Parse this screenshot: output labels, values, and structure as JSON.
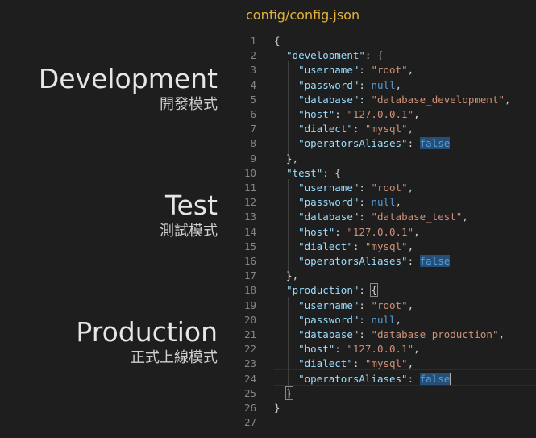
{
  "file_title": "config/config.json",
  "labels": {
    "development": {
      "title": "Development",
      "subtitle": "開發模式"
    },
    "test": {
      "title": "Test",
      "subtitle": "測試模式"
    },
    "production": {
      "title": "Production",
      "subtitle": "正式上線模式"
    }
  },
  "editor": {
    "line_numbers": [
      "1",
      "2",
      "3",
      "4",
      "5",
      "6",
      "7",
      "8",
      "9",
      "10",
      "11",
      "12",
      "13",
      "14",
      "15",
      "16",
      "17",
      "18",
      "19",
      "20",
      "21",
      "22",
      "23",
      "24",
      "25",
      "26",
      "27"
    ],
    "code": {
      "open": "{",
      "close": "}",
      "development_key": "\"development\"",
      "test_key": "\"test\"",
      "production_key": "\"production\"",
      "username_key": "\"username\"",
      "password_key": "\"password\"",
      "database_key": "\"database\"",
      "host_key": "\"host\"",
      "dialect_key": "\"dialect\"",
      "operators_key": "\"operatorsAliases\"",
      "root": "\"root\"",
      "null": "null",
      "false": "false",
      "host_value": "\"127.0.0.1\"",
      "dialect_value": "\"mysql\"",
      "db_dev": "\"database_development\"",
      "db_test": "\"database_test\"",
      "db_prod": "\"database_production\""
    }
  }
}
